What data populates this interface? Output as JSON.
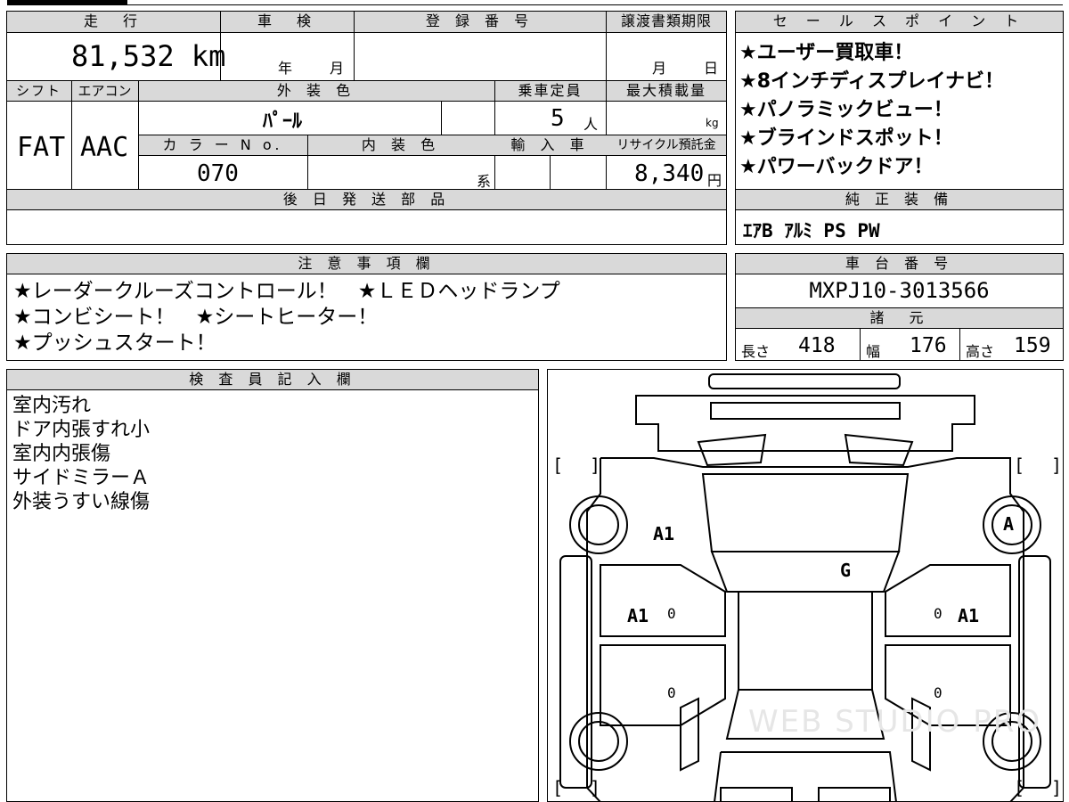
{
  "main_table": {
    "mileage_label": "走　行",
    "mileage_value": "81,532 km",
    "inspection_label": "車　検",
    "inspection_year_unit": "年",
    "inspection_month_unit": "月",
    "registration_label": "登 録 番 号",
    "transfer_docs_label": "譲渡書類期限",
    "transfer_month_unit": "月",
    "transfer_day_unit": "日",
    "shift_label": "シフト",
    "shift_value": "FAT",
    "aircon_label": "エアコン",
    "aircon_value": "AAC",
    "exterior_color_label": "外 装 色",
    "exterior_color_value": "ﾊﾟｰﾙ",
    "capacity_label": "乗車定員",
    "capacity_value": "5",
    "capacity_unit": "人",
    "max_load_label": "最大積載量",
    "max_load_unit": "kg",
    "color_no_label": "カ ラ ー N o.",
    "color_no_value": "070",
    "interior_color_label": "内 装 色",
    "interior_color_suffix": "系",
    "import_label": "輸 入 車",
    "recycle_label": "リサイクル預託金",
    "recycle_value": "8,340",
    "recycle_unit": "円",
    "later_parts_label": "後 日 発 送 部 品"
  },
  "sales_points": {
    "label": "セ ー ル ス ポ イ ン ト",
    "items": [
      "★ユーザー買取車！",
      "★8インチディスプレイナビ！",
      "★パノラミックビュー！",
      "★ブラインドスポット！",
      "★パワーバックドア！"
    ]
  },
  "genuine_equipment": {
    "label": "純 正 装 備",
    "value": "ｴｱB ｱﾙﾐ PS PW"
  },
  "notes": {
    "label": "注 意 事 項 欄",
    "lines": [
      "★レーダークルーズコントロール！　★ＬＥＤヘッドランプ",
      "★コンビシート！　★シートヒーター！",
      "★プッシュスタート！"
    ]
  },
  "chassis": {
    "label": "車 台 番 号",
    "value": "MXPJ10-3013566"
  },
  "specs": {
    "label": "諸　元",
    "length_label": "長さ",
    "length_value": "418",
    "width_label": "幅",
    "width_value": "176",
    "height_label": "高さ",
    "height_value": "159"
  },
  "inspector": {
    "label": "検 査 員 記 入 欄",
    "lines": [
      "室内汚れ",
      "ドア内張すれ小",
      "室内内張傷",
      "サイドミラーＡ",
      "外装うすい線傷"
    ]
  },
  "diagram": {
    "marks": {
      "front_left_fender": "A1",
      "front_right_tire": "A",
      "windshield": "G",
      "left_front_door": "A1",
      "right_front_door": "A1",
      "left_front_door_zero": "0",
      "right_front_door_zero": "0",
      "left_rear_door_zero": "0",
      "right_rear_door_zero": "0"
    },
    "bracket_open": "[",
    "bracket_close": "]",
    "watermark": "WEB STUDIO PRO"
  }
}
